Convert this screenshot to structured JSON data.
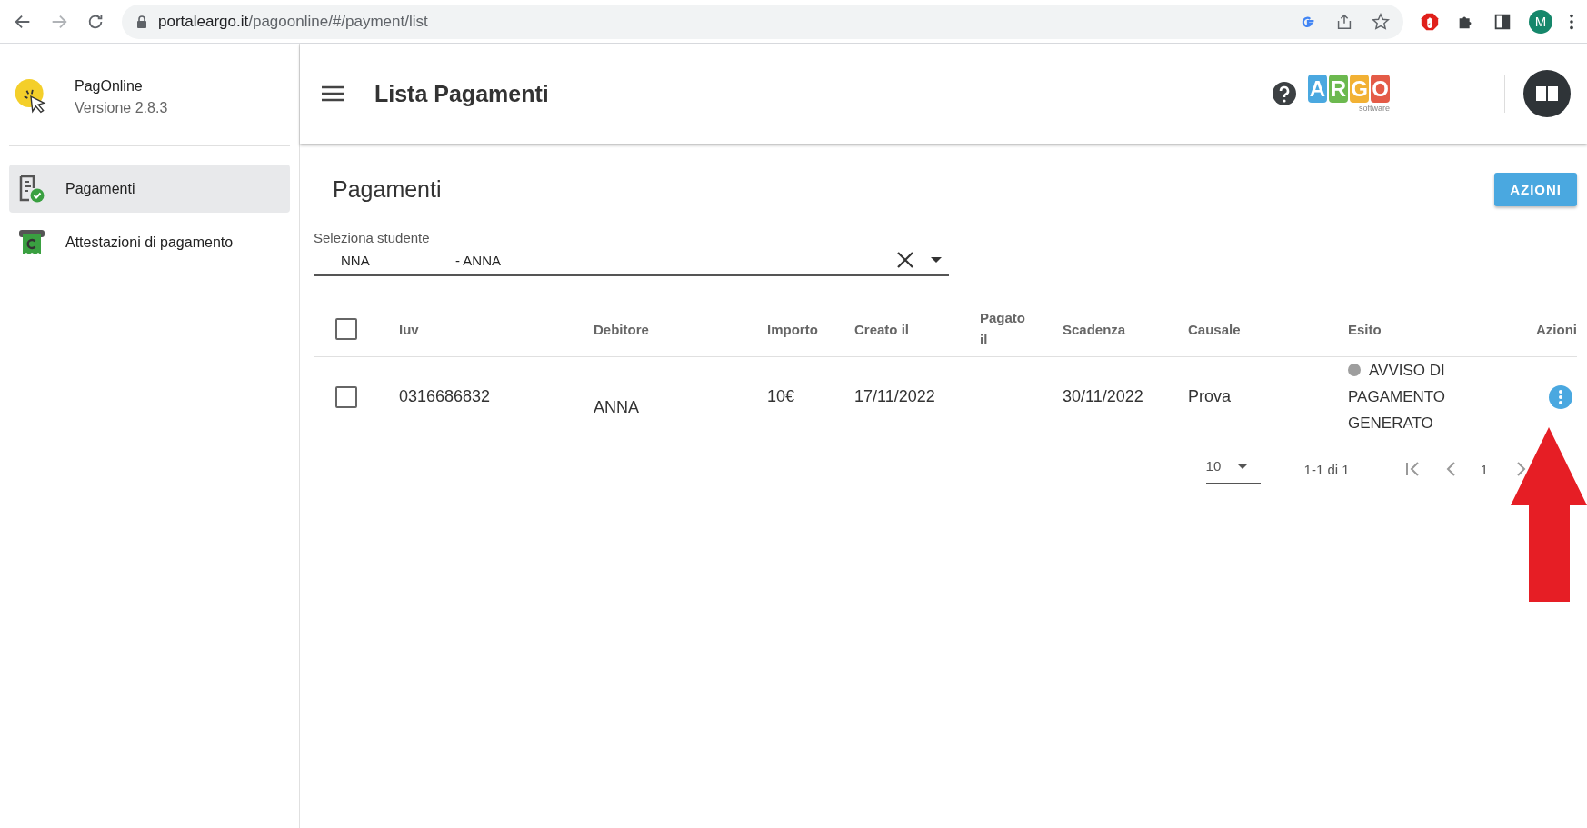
{
  "browser": {
    "url_host": "portaleargo.it",
    "url_path": "/pagoonline/#/payment/list",
    "profile_initial": "M"
  },
  "sidebar": {
    "app_name": "PagOnline",
    "version": "Versione 2.8.3",
    "items": [
      {
        "label": "Pagamenti",
        "kind": "payments",
        "selected": true
      },
      {
        "label": "Attestazioni di pagamento",
        "kind": "receipts",
        "selected": false
      }
    ]
  },
  "header": {
    "title": "Lista Pagamenti",
    "logo_letters": [
      {
        "letter": "A",
        "color": "#4aa8e0"
      },
      {
        "letter": "R",
        "color": "#6cb94f"
      },
      {
        "letter": "G",
        "color": "#f2b134"
      },
      {
        "letter": "O",
        "color": "#e45b47"
      }
    ],
    "logo_tagline": "software"
  },
  "content": {
    "title": "Pagamenti",
    "action_button": "AZIONI",
    "student_select": {
      "label": "Seleziona studente",
      "value_parts": [
        "NNA",
        "- ANNA"
      ]
    },
    "table": {
      "all_checked": false,
      "columns": [
        "Iuv",
        "Debitore",
        "Importo",
        "Creato il",
        "Pagato il",
        "Scadenza",
        "Causale",
        "Esito",
        "Azioni"
      ],
      "rows": [
        {
          "checked": false,
          "iuv": "0316686832",
          "debitore": "ANNA",
          "importo": "10€",
          "creato_il": "17/11/2022",
          "scadenza": "30/11/2022",
          "causale": "Prova",
          "esito": "AVVISO DI PAGAMENTO GENERATO",
          "color": "#9e9e9e"
        }
      ]
    },
    "pagination": {
      "rows_per_page": "10",
      "range": "1-1 di 1",
      "page": "1"
    }
  }
}
